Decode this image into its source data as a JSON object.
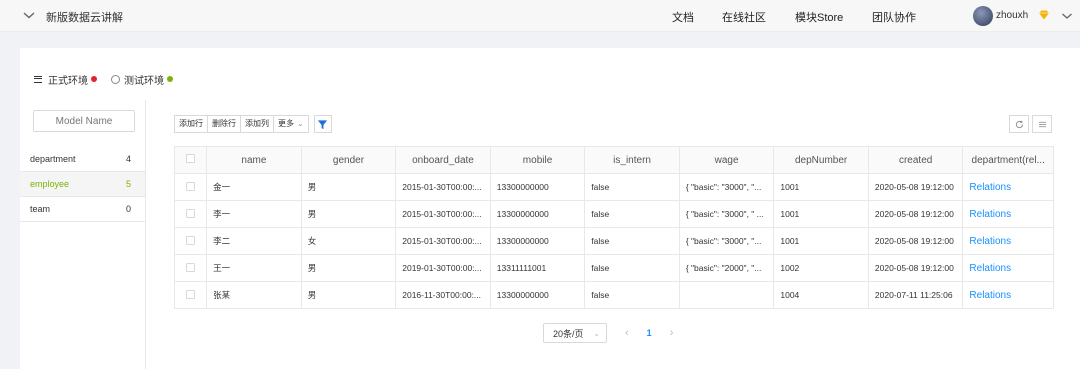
{
  "header": {
    "app_title": "新版数据云讲解",
    "nav": [
      "文档",
      "在线社区",
      "模块Store",
      "团队协作"
    ],
    "username": "zhouxh",
    "icons": {
      "toggle": "chevron-down-icon",
      "badge": "diamond-icon",
      "user_menu": "chevron-down-icon"
    }
  },
  "env": {
    "prod_label": "正式环境",
    "prod_color": "#e8202a",
    "test_label": "测试环境",
    "test_color": "#7cb305"
  },
  "sidebar": {
    "search_placeholder": "Model Name",
    "models": [
      {
        "name": "department",
        "count": "4"
      },
      {
        "name": "employee",
        "count": "5"
      },
      {
        "name": "team",
        "count": "0"
      }
    ]
  },
  "toolbar": {
    "add_row": "添加行",
    "delete_row": "删除行",
    "add_column": "添加列",
    "more": "更多",
    "filter_icon": "filter-icon",
    "refresh_icon": "refresh-icon",
    "settings_icon": "settings-icon"
  },
  "table": {
    "columns": [
      "name",
      "gender",
      "onboard_date",
      "mobile",
      "is_intern",
      "wage",
      "depNumber",
      "created",
      "department(rel..."
    ],
    "rows": [
      [
        "金一",
        "男",
        "2015-01-30T00:00:...",
        "13300000000",
        "false",
        "{ \"basic\": \"3000\", \"...",
        "1001",
        "2020-05-08 19:12:00",
        "Relations"
      ],
      [
        "李一",
        "男",
        "2015-01-30T00:00:...",
        "13300000000",
        "false",
        "{ \"basic\": \"3000\", \" ...",
        "1001",
        "2020-05-08 19:12:00",
        "Relations"
      ],
      [
        "李二",
        "女",
        "2015-01-30T00:00:...",
        "13300000000",
        "false",
        "{ \"basic\": \"3000\", \"...",
        "1001",
        "2020-05-08 19:12:00",
        "Relations"
      ],
      [
        "王一",
        "男",
        "2019-01-30T00:00:...",
        "13311111001",
        "false",
        "{ \"basic\": \"2000\", \"...",
        "1002",
        "2020-05-08 19:12:00",
        "Relations"
      ],
      [
        "张某",
        "男",
        "2016-11-30T00:00:...",
        "13300000000",
        "false",
        "",
        "1004",
        "2020-07-11 11:25:06",
        "Relations"
      ]
    ]
  },
  "pagination": {
    "page_size": "20条/页",
    "current_page": "1"
  }
}
